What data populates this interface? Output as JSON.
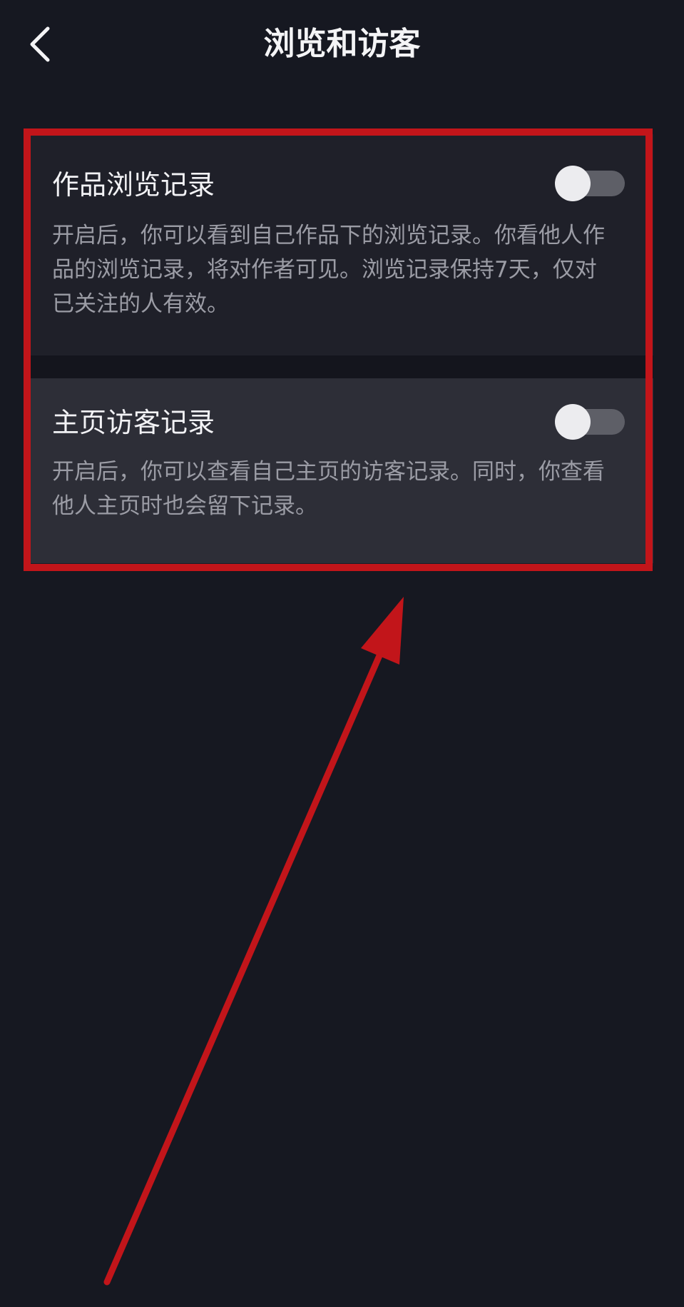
{
  "nav": {
    "title": "浏览和访客",
    "back_icon": "chevron-left-icon"
  },
  "settings": [
    {
      "title": "作品浏览记录",
      "description": "开启后，你可以看到自己作品下的浏览记录。你看他人作品的浏览记录，将对作者可见。浏览记录保持7天，仅对已关注的人有效。",
      "enabled": false
    },
    {
      "title": "主页访客记录",
      "description": "开启后，你可以查看自己主页的访客记录。同时，你查看他人主页时也会留下记录。",
      "enabled": false
    }
  ],
  "colors": {
    "background": "#161821",
    "annotation": "#c2151a",
    "toggle_track": "#5e5f67",
    "toggle_knob": "#ececef"
  }
}
